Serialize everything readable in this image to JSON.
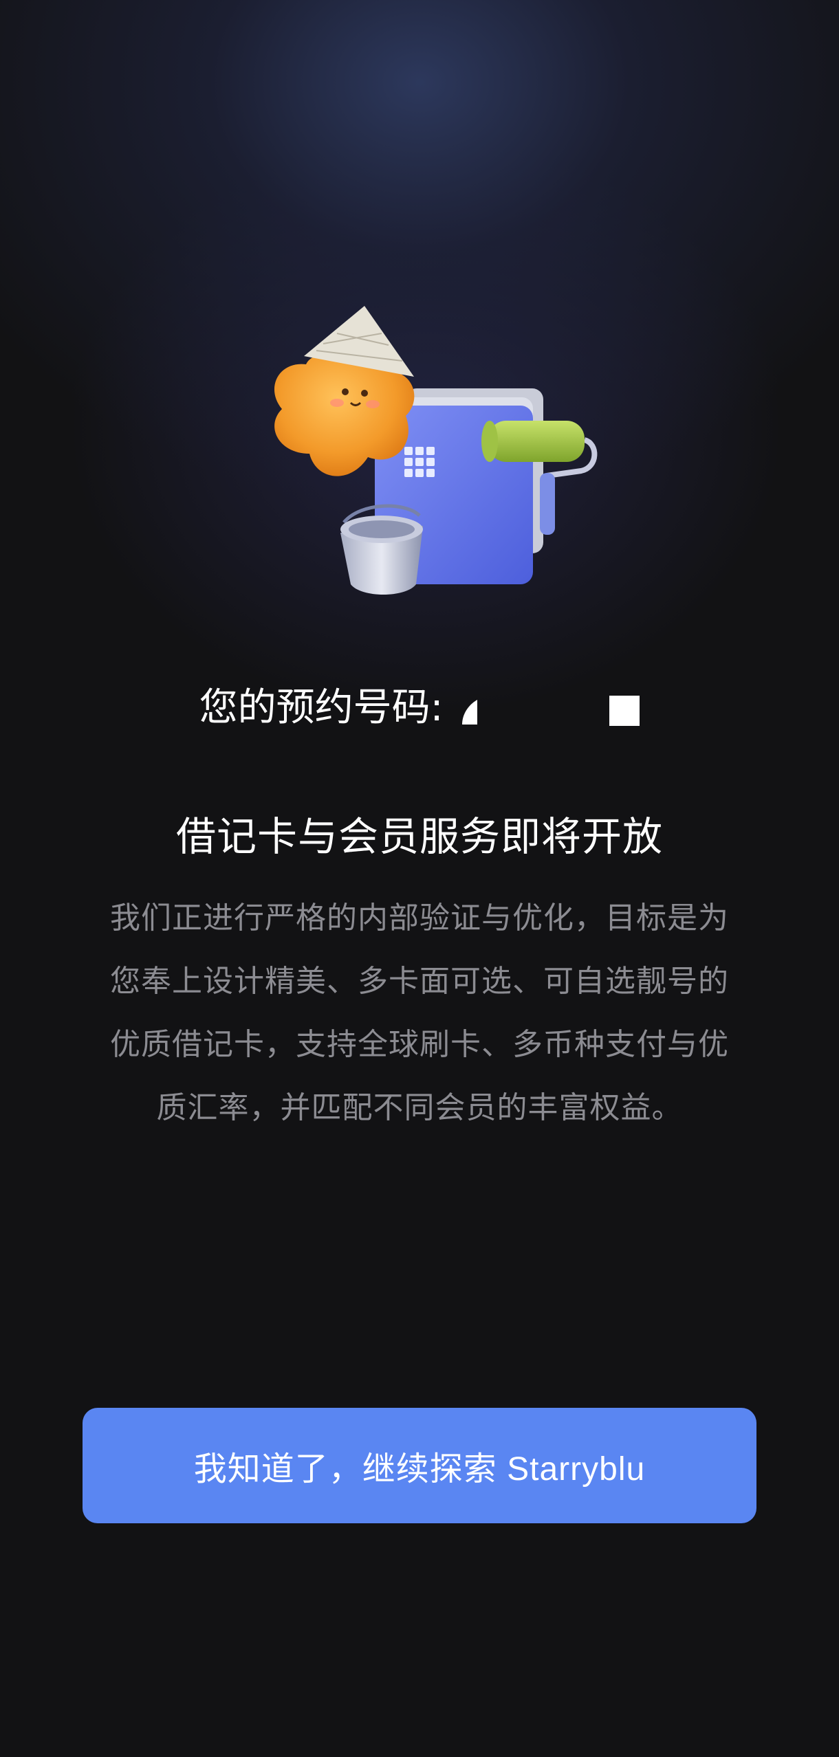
{
  "reservation": {
    "label": "您的预约号码:"
  },
  "notice": {
    "title": "借记卡与会员服务即将开放",
    "description": "我们正进行严格的内部验证与优化，目标是为您奉上设计精美、多卡面可选、可自选靓号的优质借记卡，支持全球刷卡、多币种支付与优质汇率，并匹配不同会员的丰富权益。"
  },
  "actions": {
    "continue_label": "我知道了，继续探索 Starryblu"
  },
  "colors": {
    "background": "#121214",
    "button": "#5a86f2",
    "secondary_text": "#8c8c92"
  },
  "icons": {
    "hero": "mascot-with-card-illustration"
  }
}
